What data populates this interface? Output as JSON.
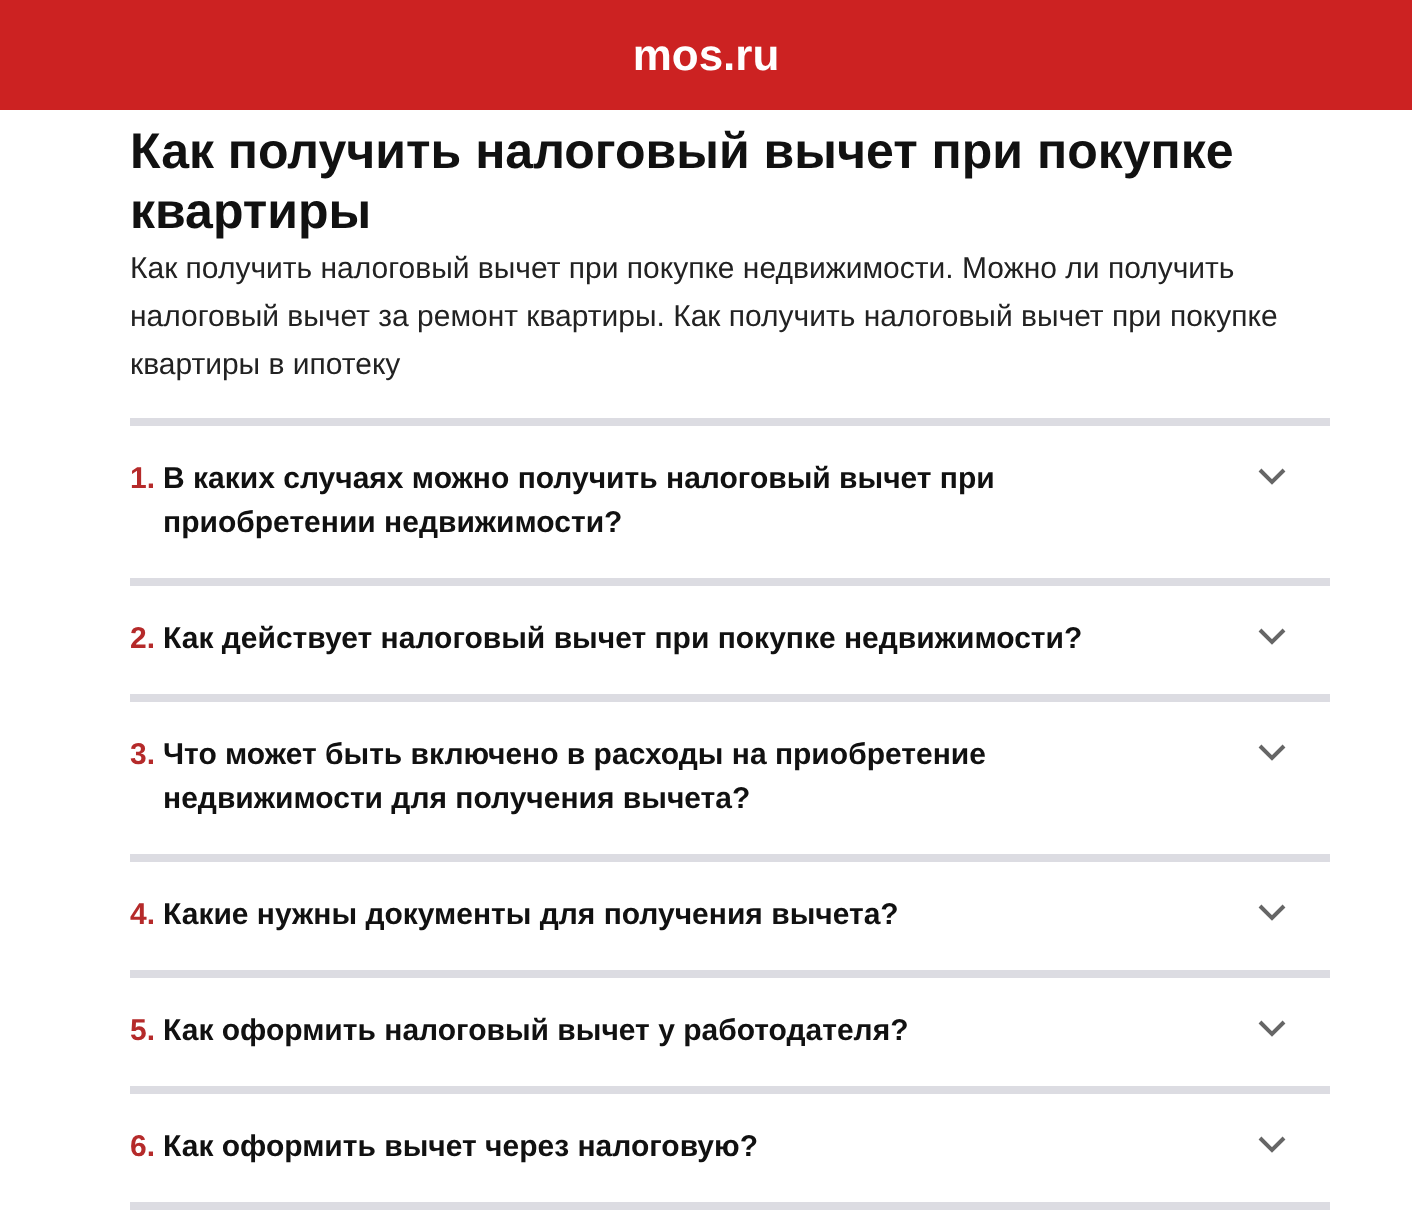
{
  "header": {
    "logo": "mos.ru"
  },
  "article": {
    "title": "Как получить налоговый вычет при покупке квартиры",
    "intro": "Как получить налоговый вычет при покупке недвижимости. Можно ли получить налоговый вычет за ремонт квартиры. Как получить налоговый вычет при покупке квартиры в ипотеку"
  },
  "faq": [
    {
      "number": "1.",
      "question": "В каких случаях можно получить налоговый вычет при приобретении недвижимости?",
      "expanded": false
    },
    {
      "number": "2.",
      "question": "Как действует налоговый вычет при покупке недвижимости?",
      "expanded": false
    },
    {
      "number": "3.",
      "question": "Что может быть включено в расходы на приобретение недвижимости для получения вычета?",
      "expanded": false
    },
    {
      "number": "4.",
      "question": "Какие нужны документы для получения вычета?",
      "expanded": false
    },
    {
      "number": "5.",
      "question": "Как оформить налоговый вычет у работодателя?",
      "expanded": false
    },
    {
      "number": "6.",
      "question": "Как оформить вычет через налоговую?",
      "expanded": false
    }
  ]
}
